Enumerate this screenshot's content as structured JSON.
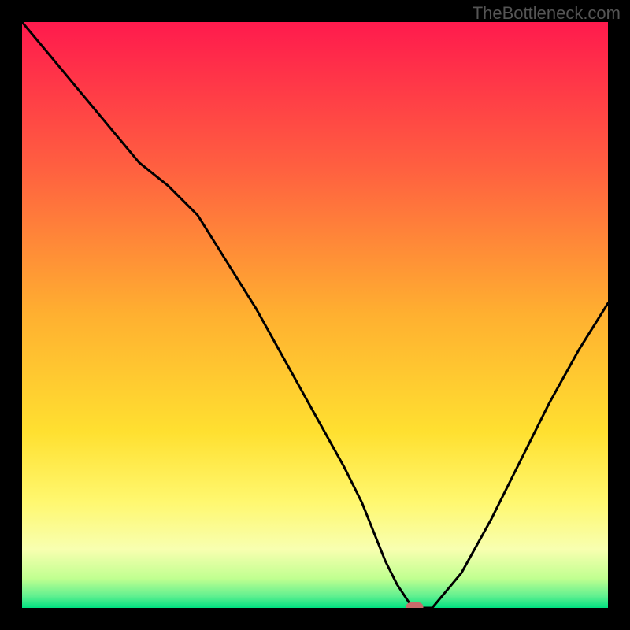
{
  "watermark": "TheBottleneck.com",
  "chart_data": {
    "type": "line",
    "title": "",
    "xlabel": "",
    "ylabel": "",
    "xlim": [
      0,
      100
    ],
    "ylim": [
      0,
      100
    ],
    "x": [
      0,
      5,
      10,
      15,
      20,
      25,
      30,
      35,
      40,
      45,
      50,
      55,
      58,
      60,
      62,
      64,
      66,
      68,
      70,
      75,
      80,
      85,
      90,
      95,
      100
    ],
    "y": [
      100,
      94,
      88,
      82,
      76,
      72,
      67,
      59,
      51,
      42,
      33,
      24,
      18,
      13,
      8,
      4,
      1,
      0,
      0,
      6,
      15,
      25,
      35,
      44,
      52
    ],
    "marker": {
      "x": 67,
      "y": 0,
      "color": "#c96b6b"
    },
    "gradient_stops": [
      {
        "offset": 0,
        "color": "#ff1a4d"
      },
      {
        "offset": 25,
        "color": "#ff6040"
      },
      {
        "offset": 50,
        "color": "#ffb030"
      },
      {
        "offset": 70,
        "color": "#ffe030"
      },
      {
        "offset": 82,
        "color": "#fff870"
      },
      {
        "offset": 90,
        "color": "#f8ffb0"
      },
      {
        "offset": 95,
        "color": "#c0ff90"
      },
      {
        "offset": 98,
        "color": "#60f090"
      },
      {
        "offset": 100,
        "color": "#00e080"
      }
    ]
  }
}
